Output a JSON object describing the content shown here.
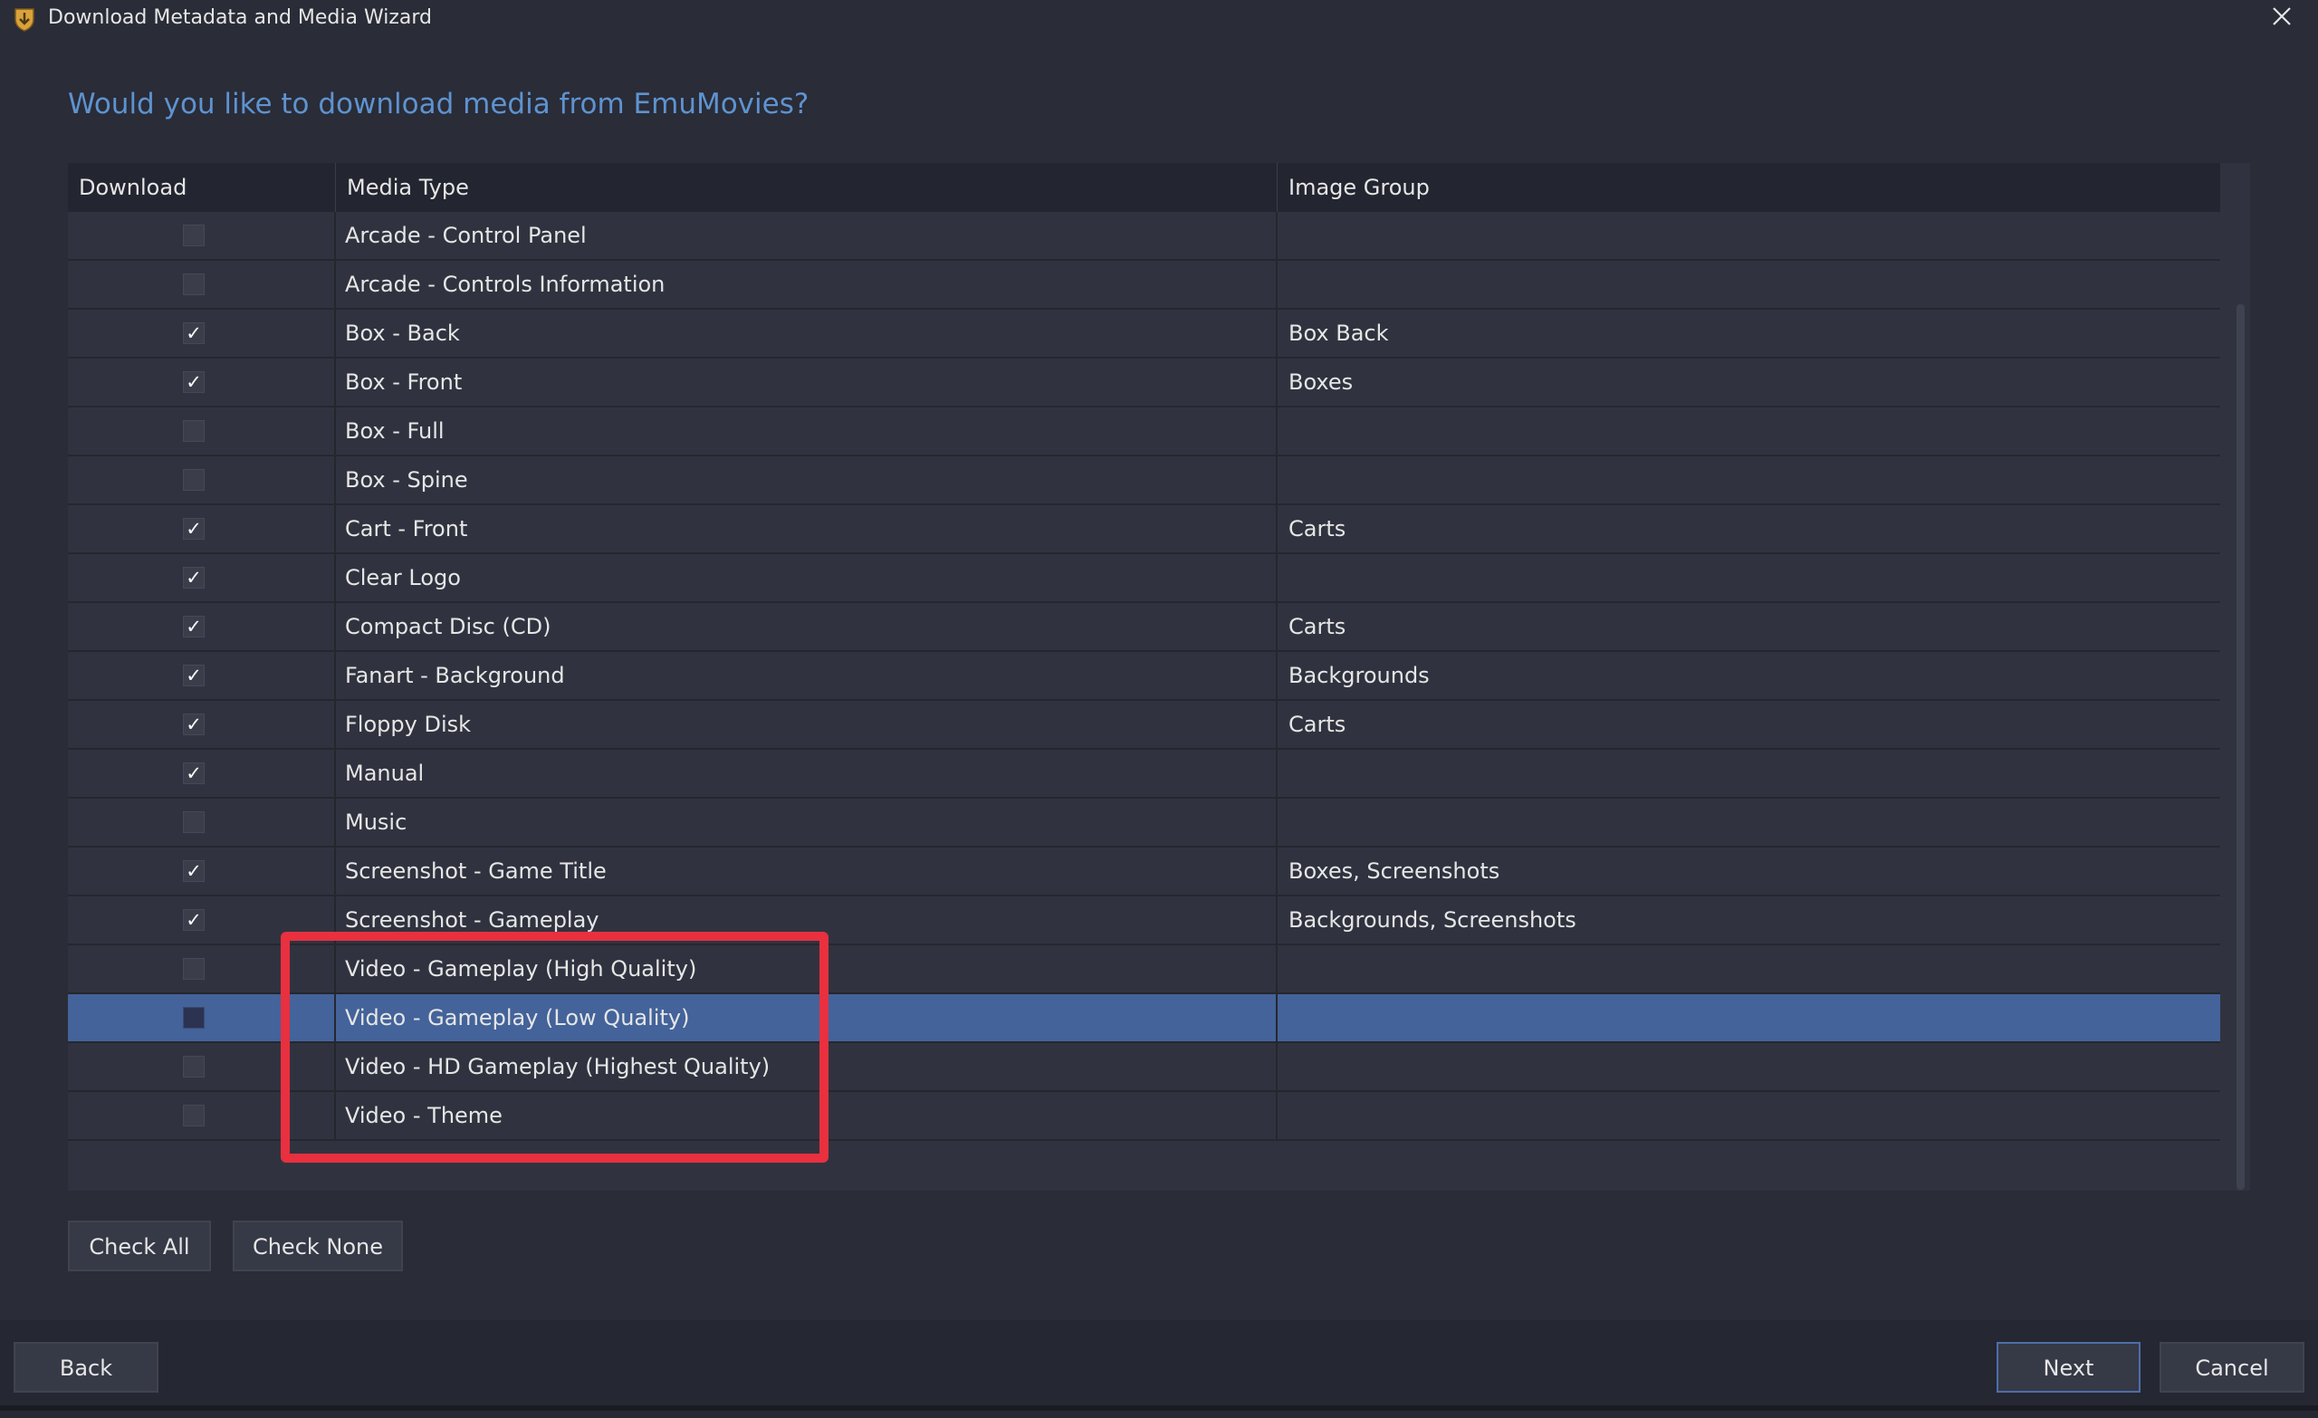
{
  "window": {
    "title": "Download Metadata and Media Wizard"
  },
  "page": {
    "question": "Would you like to download media from EmuMovies?"
  },
  "grid": {
    "columns": {
      "download": "Download",
      "media_type": "Media Type",
      "image_group": "Image Group"
    },
    "rows": [
      {
        "checked": false,
        "media_type": "Arcade - Control Panel",
        "image_group": ""
      },
      {
        "checked": false,
        "media_type": "Arcade - Controls Information",
        "image_group": ""
      },
      {
        "checked": true,
        "media_type": "Box - Back",
        "image_group": "Box Back"
      },
      {
        "checked": true,
        "media_type": "Box - Front",
        "image_group": "Boxes"
      },
      {
        "checked": false,
        "media_type": "Box - Full",
        "image_group": ""
      },
      {
        "checked": false,
        "media_type": "Box - Spine",
        "image_group": ""
      },
      {
        "checked": true,
        "media_type": "Cart - Front",
        "image_group": "Carts"
      },
      {
        "checked": true,
        "media_type": "Clear Logo",
        "image_group": ""
      },
      {
        "checked": true,
        "media_type": "Compact Disc (CD)",
        "image_group": "Carts"
      },
      {
        "checked": true,
        "media_type": "Fanart - Background",
        "image_group": "Backgrounds"
      },
      {
        "checked": true,
        "media_type": "Floppy Disk",
        "image_group": "Carts"
      },
      {
        "checked": true,
        "media_type": "Manual",
        "image_group": ""
      },
      {
        "checked": false,
        "media_type": "Music",
        "image_group": ""
      },
      {
        "checked": true,
        "media_type": "Screenshot - Game Title",
        "image_group": "Boxes, Screenshots"
      },
      {
        "checked": true,
        "media_type": "Screenshot - Gameplay",
        "image_group": "Backgrounds, Screenshots"
      },
      {
        "checked": false,
        "media_type": "Video - Gameplay (High Quality)",
        "image_group": ""
      },
      {
        "checked": false,
        "media_type": "Video - Gameplay (Low Quality)",
        "image_group": "",
        "selected": true
      },
      {
        "checked": false,
        "media_type": "Video - HD Gameplay (Highest Quality)",
        "image_group": ""
      },
      {
        "checked": false,
        "media_type": "Video - Theme",
        "image_group": ""
      }
    ]
  },
  "buttons": {
    "check_all": "Check All",
    "check_none": "Check None",
    "back": "Back",
    "next": "Next",
    "cancel": "Cancel"
  },
  "icons": {
    "app": "shield-download-icon",
    "close": "close-icon",
    "check": "✓"
  },
  "colors": {
    "accent": "#5e93d0",
    "selected_row": "#43639a",
    "highlight": "#e8303f"
  }
}
